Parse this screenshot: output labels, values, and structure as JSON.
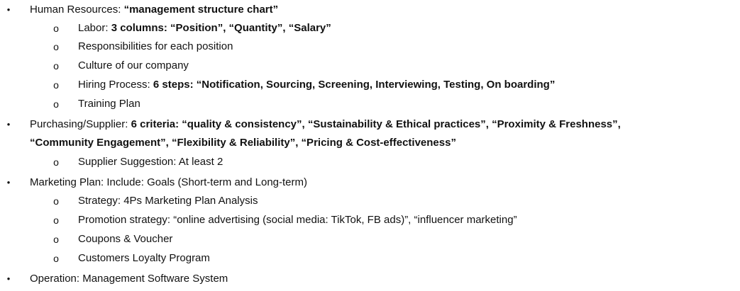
{
  "bullets": {
    "level1": "•",
    "level2": "o"
  },
  "items": {
    "hr": {
      "label": "Human Resources: ",
      "bold": "“management structure chart”",
      "subs": {
        "labor": {
          "label": "Labor: ",
          "bold": "3 columns: “Position”, “Quantity”, “Salary”"
        },
        "responsibilities": {
          "label": "Responsibilities for each position"
        },
        "culture": {
          "label": "Culture of our company"
        },
        "hiring": {
          "label": "Hiring Process: ",
          "bold": "6 steps: “Notification, Sourcing, Screening, Interviewing, Testing, On boarding”"
        },
        "training": {
          "label": "Training Plan"
        }
      }
    },
    "purchasing": {
      "label": "Purchasing/Supplier: ",
      "bold_line1": "6 criteria: “quality & consistency”, “Sustainability & Ethical practices”, “Proximity & Freshness”,",
      "bold_line2": "“Community Engagement”, “Flexibility & Reliability”, “Pricing & Cost-effectiveness”",
      "subs": {
        "supplier": {
          "label": "Supplier Suggestion: At least 2"
        }
      }
    },
    "marketing": {
      "label": "Marketing Plan: Include: Goals (Short-term and Long-term)",
      "subs": {
        "strategy": {
          "label": "Strategy: 4Ps Marketing Plan Analysis"
        },
        "promotion": {
          "label": "Promotion strategy: “online advertising (social media: TikTok, FB ads)”, “influencer marketing”"
        },
        "coupons": {
          "label": "Coupons & Voucher"
        },
        "loyalty": {
          "label": "Customers Loyalty Program"
        }
      }
    },
    "operation": {
      "label": "Operation: Management Software System"
    }
  }
}
